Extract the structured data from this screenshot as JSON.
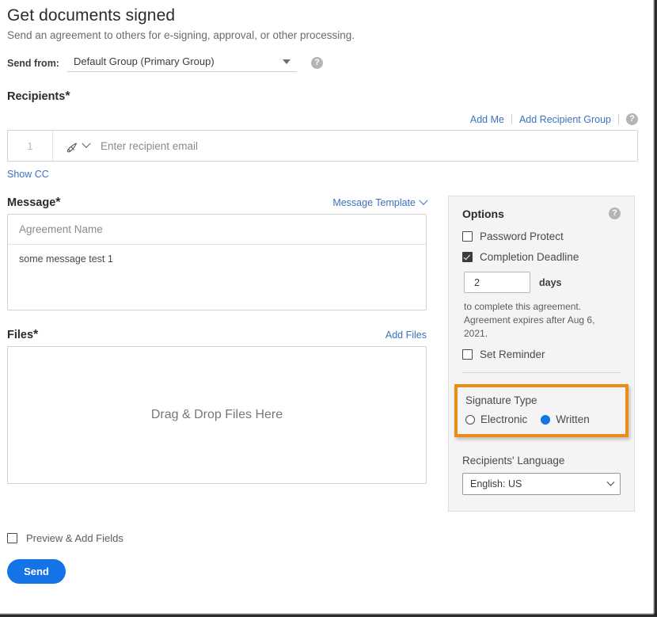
{
  "page": {
    "title": "Get documents signed",
    "subtitle": "Send an agreement to others for e-signing, approval, or other processing."
  },
  "send_from": {
    "label": "Send from:",
    "value": "Default Group (Primary Group)",
    "help": "?"
  },
  "recipients": {
    "title": "Recipients",
    "required_mark": "*",
    "add_me_label": "Add Me",
    "add_recipient_group_label": "Add Recipient Group",
    "help": "?",
    "row_number": "1",
    "email_placeholder": "Enter recipient email",
    "show_cc_label": "Show CC"
  },
  "message": {
    "title": "Message",
    "required_mark": "*",
    "template_link": "Message Template",
    "agreement_name_placeholder": "Agreement Name",
    "body_value": "some message test 1"
  },
  "files": {
    "title": "Files",
    "required_mark": "*",
    "add_files_link": "Add Files",
    "dropzone_text": "Drag & Drop Files Here"
  },
  "options": {
    "title": "Options",
    "help": "?",
    "password_protect": {
      "label": "Password Protect",
      "checked": false
    },
    "completion_deadline": {
      "label": "Completion Deadline",
      "checked": true
    },
    "days_value": "2",
    "days_unit": "days",
    "note_line1": "to complete this agreement.",
    "note_line2": "Agreement expires after Aug 6, 2021.",
    "set_reminder": {
      "label": "Set Reminder",
      "checked": false
    },
    "signature_type": {
      "title": "Signature Type",
      "highlight_color": "#ed8b19",
      "electronic_label": "Electronic",
      "written_label": "Written",
      "selected": "Written"
    },
    "language": {
      "title": "Recipients' Language",
      "selected": "English: US"
    }
  },
  "footer": {
    "preview_label": "Preview & Add Fields",
    "preview_checked": false,
    "send_label": "Send"
  },
  "colors": {
    "accent_blue": "#1473e6",
    "link_blue": "#3a73bc",
    "highlight_orange": "#ed8b19",
    "panel_bg": "#f4f4f4"
  }
}
